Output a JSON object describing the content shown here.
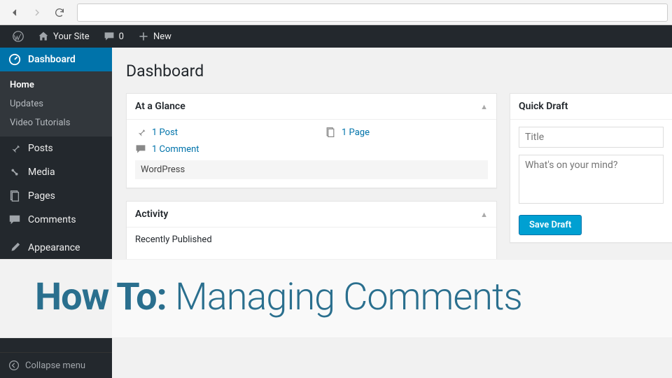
{
  "adminbar": {
    "site_name": "Your Site",
    "comments_count": "0",
    "new_label": "New"
  },
  "sidebar": {
    "dashboard": "Dashboard",
    "submenu": {
      "home": "Home",
      "updates": "Updates",
      "tutorials": "Video Tutorials"
    },
    "posts": "Posts",
    "media": "Media",
    "pages": "Pages",
    "comments": "Comments",
    "appearance": "Appearance",
    "collapse": "Collapse menu"
  },
  "page": {
    "title": "Dashboard"
  },
  "glance": {
    "title": "At a Glance",
    "post": "1 Post",
    "page": "1 Page",
    "comment": "1 Comment",
    "version": "WordPress"
  },
  "activity": {
    "title": "Activity",
    "recently": "Recently Published"
  },
  "quickdraft": {
    "title": "Quick Draft",
    "title_placeholder": "Title",
    "content_placeholder": "What's on your mind?",
    "save": "Save Draft"
  },
  "overlay": {
    "prefix": "How To:",
    "rest": " Managing Comments"
  }
}
